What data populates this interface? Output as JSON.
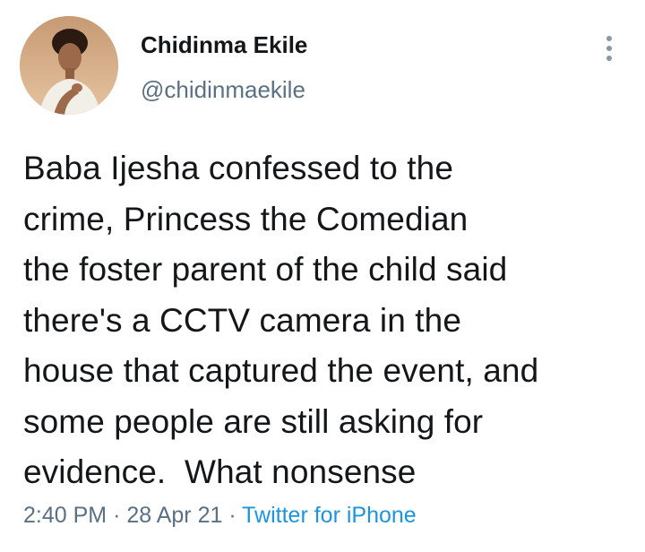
{
  "tweet": {
    "author": {
      "display_name": "Chidinma Ekile",
      "handle": "@chidinmaekile",
      "avatar_icon": "profile-photo"
    },
    "more_icon": "more-vertical-icon",
    "text": "Baba Ijesha confessed to the\ncrime, Princess the Comedian\nthe foster parent of the child said\nthere's a CCTV camera in the\nhouse that captured the event, and\nsome people are still asking for\nevidence.  What nonsense",
    "time": "2:40 PM",
    "separator": "·",
    "date": "28 Apr 21",
    "source": "Twitter for iPhone"
  },
  "colors": {
    "text_primary": "#14171a",
    "text_secondary": "#5b7083",
    "link": "#1b95e0",
    "background": "#ffffff"
  }
}
